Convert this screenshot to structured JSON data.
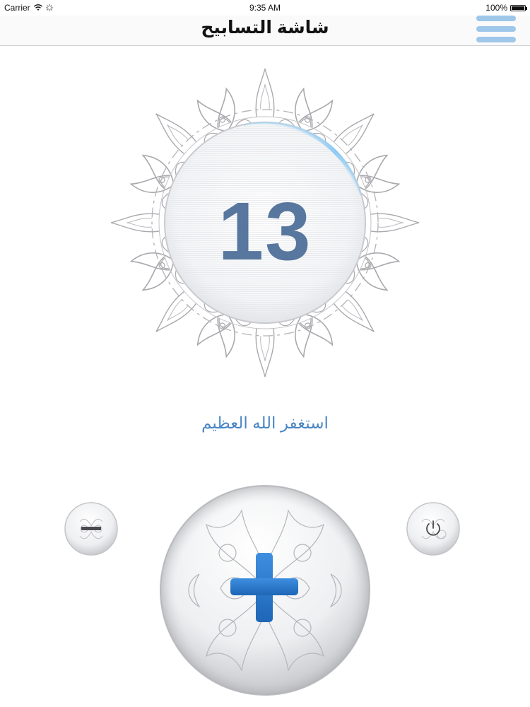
{
  "status_bar": {
    "carrier": "Carrier",
    "time": "9:35 AM",
    "battery_percent": "100%",
    "battery_level": 1.0
  },
  "nav": {
    "title": "شاشة التسابيح",
    "menu_icon": "hamburger-menu-icon"
  },
  "counter": {
    "value": "13"
  },
  "dhikr": {
    "text": "استغفر الله العظيم"
  },
  "controls": {
    "decrement_icon": "minus-icon",
    "increment_icon": "plus-icon",
    "reset_icon": "power-icon"
  },
  "colors": {
    "counter_text": "#58779f",
    "dhikr_text": "#4b86c4",
    "plus_sign": "#2a78cc",
    "menu_bars": "#9fc7ea",
    "ornament": "#a9a9ae"
  }
}
